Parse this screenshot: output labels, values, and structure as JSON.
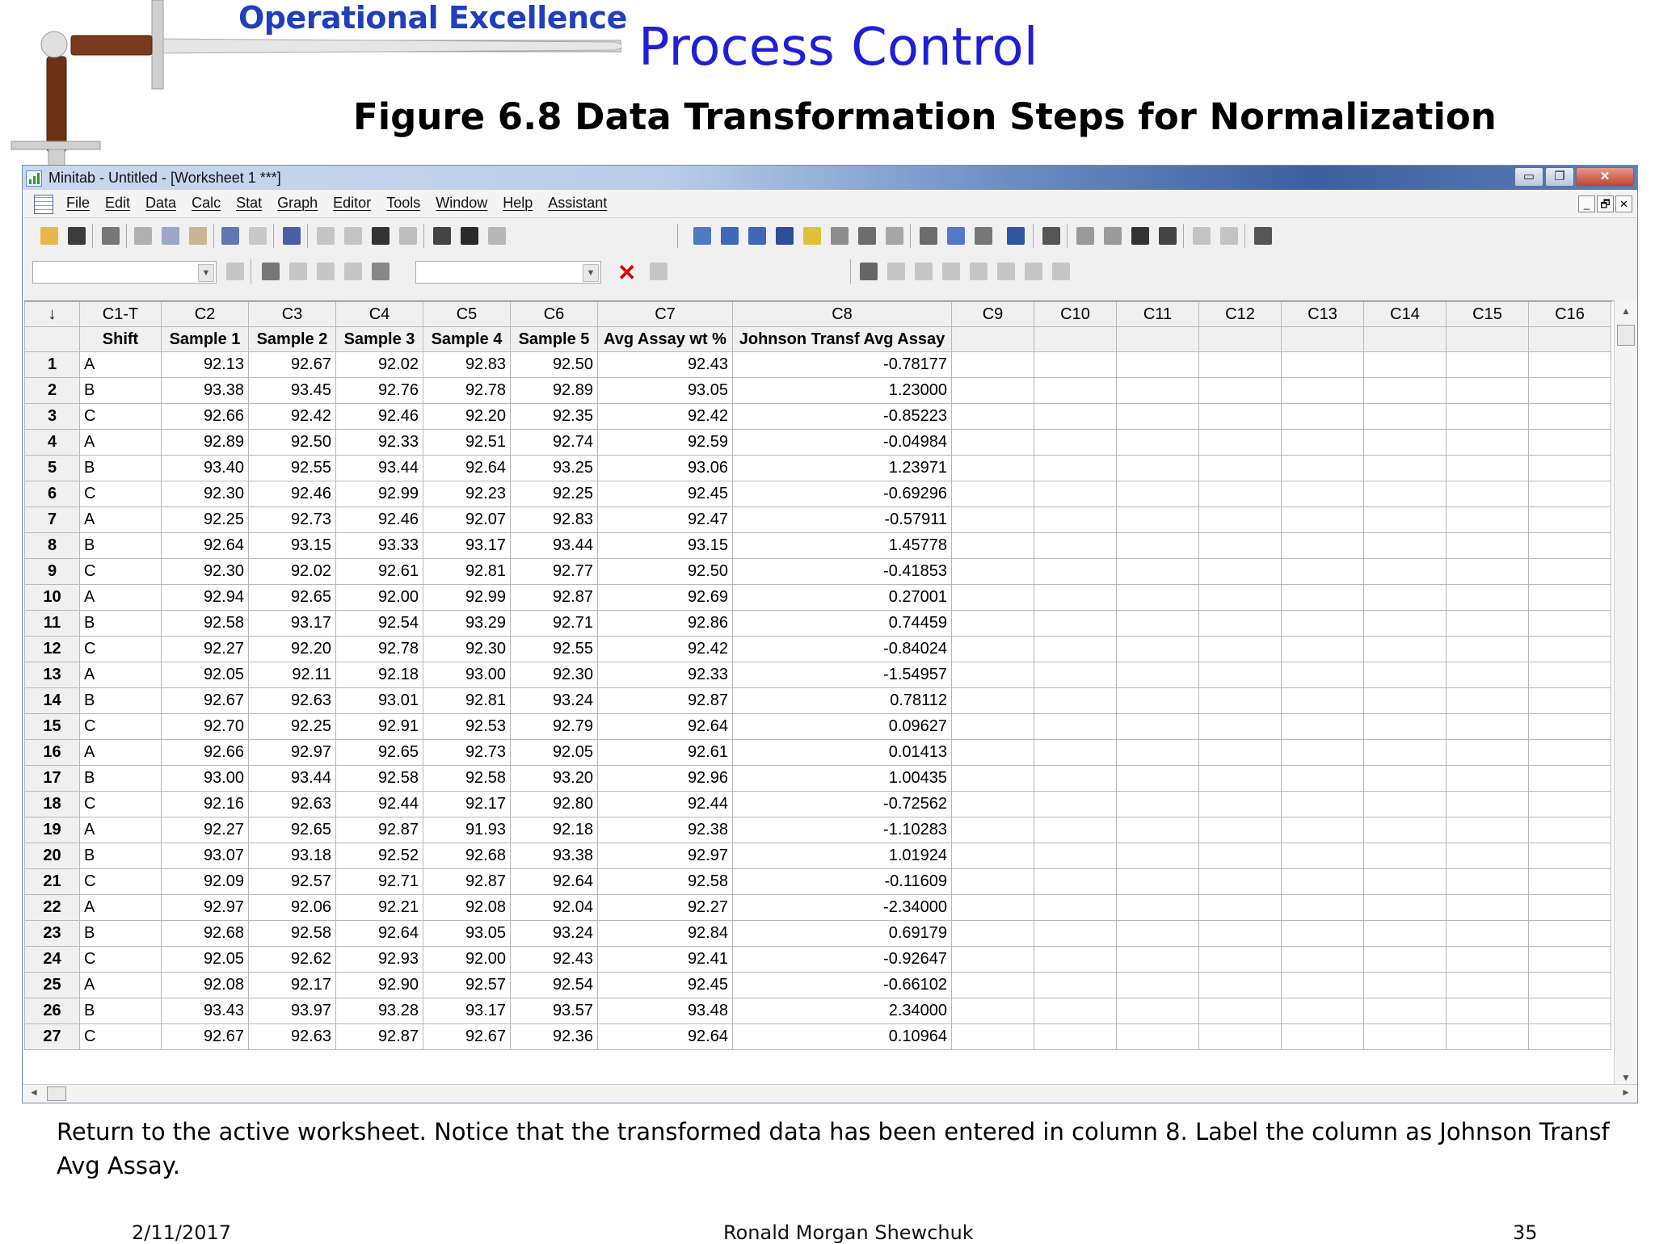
{
  "slide": {
    "brand": "Operational Excellence",
    "topic": "Process Control",
    "figure_title": "Figure 6.8  Data Transformation Steps for Normalization",
    "caption": "Return to the active worksheet.  Notice that the transformed data has been entered in column 8.  Label the column as Johnson Transf Avg Assay.",
    "footer": {
      "date": "2/11/2017",
      "author": "Ronald Morgan Shewchuk",
      "page": "35"
    }
  },
  "window": {
    "title": "Minitab - Untitled - [Worksheet 1 ***]",
    "controls": {
      "minimize": "▭",
      "restore": "❐",
      "close": "✕"
    },
    "menu": [
      "File",
      "Edit",
      "Data",
      "Calc",
      "Stat",
      "Graph",
      "Editor",
      "Tools",
      "Window",
      "Help",
      "Assistant"
    ],
    "mdi_controls": [
      "_",
      "🗗",
      "✕"
    ]
  },
  "worksheet": {
    "corner": "↓",
    "column_ids": [
      "C1-T",
      "C2",
      "C3",
      "C4",
      "C5",
      "C6",
      "C7",
      "C8",
      "C9",
      "C10",
      "C11",
      "C12",
      "C13",
      "C14",
      "C15",
      "C16"
    ],
    "column_names": [
      "Shift",
      "Sample 1",
      "Sample 2",
      "Sample 3",
      "Sample 4",
      "Sample 5",
      "Avg Assay wt %",
      "Johnson Transf Avg Assay",
      "",
      "",
      "",
      "",
      "",
      "",
      "",
      ""
    ],
    "rows": [
      [
        "1",
        "A",
        "92.13",
        "92.67",
        "92.02",
        "92.83",
        "92.50",
        "92.43",
        "-0.78177"
      ],
      [
        "2",
        "B",
        "93.38",
        "93.45",
        "92.76",
        "92.78",
        "92.89",
        "93.05",
        "1.23000"
      ],
      [
        "3",
        "C",
        "92.66",
        "92.42",
        "92.46",
        "92.20",
        "92.35",
        "92.42",
        "-0.85223"
      ],
      [
        "4",
        "A",
        "92.89",
        "92.50",
        "92.33",
        "92.51",
        "92.74",
        "92.59",
        "-0.04984"
      ],
      [
        "5",
        "B",
        "93.40",
        "92.55",
        "93.44",
        "92.64",
        "93.25",
        "93.06",
        "1.23971"
      ],
      [
        "6",
        "C",
        "92.30",
        "92.46",
        "92.99",
        "92.23",
        "92.25",
        "92.45",
        "-0.69296"
      ],
      [
        "7",
        "A",
        "92.25",
        "92.73",
        "92.46",
        "92.07",
        "92.83",
        "92.47",
        "-0.57911"
      ],
      [
        "8",
        "B",
        "92.64",
        "93.15",
        "93.33",
        "93.17",
        "93.44",
        "93.15",
        "1.45778"
      ],
      [
        "9",
        "C",
        "92.30",
        "92.02",
        "92.61",
        "92.81",
        "92.77",
        "92.50",
        "-0.41853"
      ],
      [
        "10",
        "A",
        "92.94",
        "92.65",
        "92.00",
        "92.99",
        "92.87",
        "92.69",
        "0.27001"
      ],
      [
        "11",
        "B",
        "92.58",
        "93.17",
        "92.54",
        "93.29",
        "92.71",
        "92.86",
        "0.74459"
      ],
      [
        "12",
        "C",
        "92.27",
        "92.20",
        "92.78",
        "92.30",
        "92.55",
        "92.42",
        "-0.84024"
      ],
      [
        "13",
        "A",
        "92.05",
        "92.11",
        "92.18",
        "93.00",
        "92.30",
        "92.33",
        "-1.54957"
      ],
      [
        "14",
        "B",
        "92.67",
        "92.63",
        "93.01",
        "92.81",
        "93.24",
        "92.87",
        "0.78112"
      ],
      [
        "15",
        "C",
        "92.70",
        "92.25",
        "92.91",
        "92.53",
        "92.79",
        "92.64",
        "0.09627"
      ],
      [
        "16",
        "A",
        "92.66",
        "92.97",
        "92.65",
        "92.73",
        "92.05",
        "92.61",
        "0.01413"
      ],
      [
        "17",
        "B",
        "93.00",
        "93.44",
        "92.58",
        "92.58",
        "93.20",
        "92.96",
        "1.00435"
      ],
      [
        "18",
        "C",
        "92.16",
        "92.63",
        "92.44",
        "92.17",
        "92.80",
        "92.44",
        "-0.72562"
      ],
      [
        "19",
        "A",
        "92.27",
        "92.65",
        "92.87",
        "91.93",
        "92.18",
        "92.38",
        "-1.10283"
      ],
      [
        "20",
        "B",
        "93.07",
        "93.18",
        "92.52",
        "92.68",
        "93.38",
        "92.97",
        "1.01924"
      ],
      [
        "21",
        "C",
        "92.09",
        "92.57",
        "92.71",
        "92.87",
        "92.64",
        "92.58",
        "-0.11609"
      ],
      [
        "22",
        "A",
        "92.97",
        "92.06",
        "92.21",
        "92.08",
        "92.04",
        "92.27",
        "-2.34000"
      ],
      [
        "23",
        "B",
        "92.68",
        "92.58",
        "92.64",
        "93.05",
        "93.24",
        "92.84",
        "0.69179"
      ],
      [
        "24",
        "C",
        "92.05",
        "92.62",
        "92.93",
        "92.00",
        "92.43",
        "92.41",
        "-0.92647"
      ],
      [
        "25",
        "A",
        "92.08",
        "92.17",
        "92.90",
        "92.57",
        "92.54",
        "92.45",
        "-0.66102"
      ],
      [
        "26",
        "B",
        "93.43",
        "93.97",
        "93.28",
        "93.17",
        "93.57",
        "93.48",
        "2.34000"
      ],
      [
        "27",
        "C",
        "92.67",
        "92.63",
        "92.87",
        "92.67",
        "92.36",
        "92.64",
        "0.10964"
      ]
    ]
  }
}
